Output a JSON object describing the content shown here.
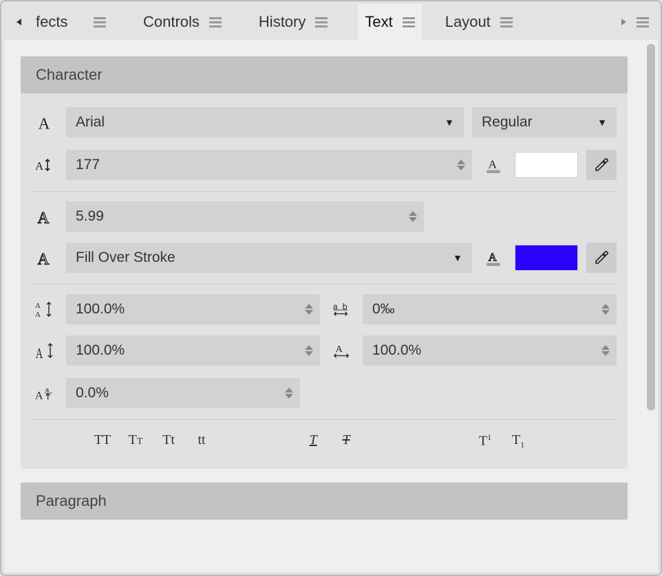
{
  "tabs": {
    "t0": "fects",
    "t1": "Controls",
    "t2": "History",
    "t3": "Text",
    "t4": "Layout"
  },
  "panels": {
    "character": {
      "title": "Character",
      "font_family": "Arial",
      "font_weight": "Regular",
      "font_size": "177",
      "text_color": "#ffffff",
      "stroke_width": "5.99",
      "stroke_order": "Fill Over Stroke",
      "stroke_color": "#2a00ff",
      "leading": "100.0%",
      "tracking": "0‰",
      "vertical_scale": "100.0%",
      "horizontal_scale": "100.0%",
      "baseline_shift": "0.0%",
      "styles": {
        "uppercase": "TT",
        "smallcaps": "Tᴛ",
        "titlecase": "Tt",
        "lowercase": "tt",
        "underline": "T",
        "strike": "T",
        "superscript_t": "T",
        "superscript_1": "1",
        "subscript_t": "T",
        "subscript_1": "1"
      }
    },
    "paragraph": {
      "title": "Paragraph"
    }
  }
}
